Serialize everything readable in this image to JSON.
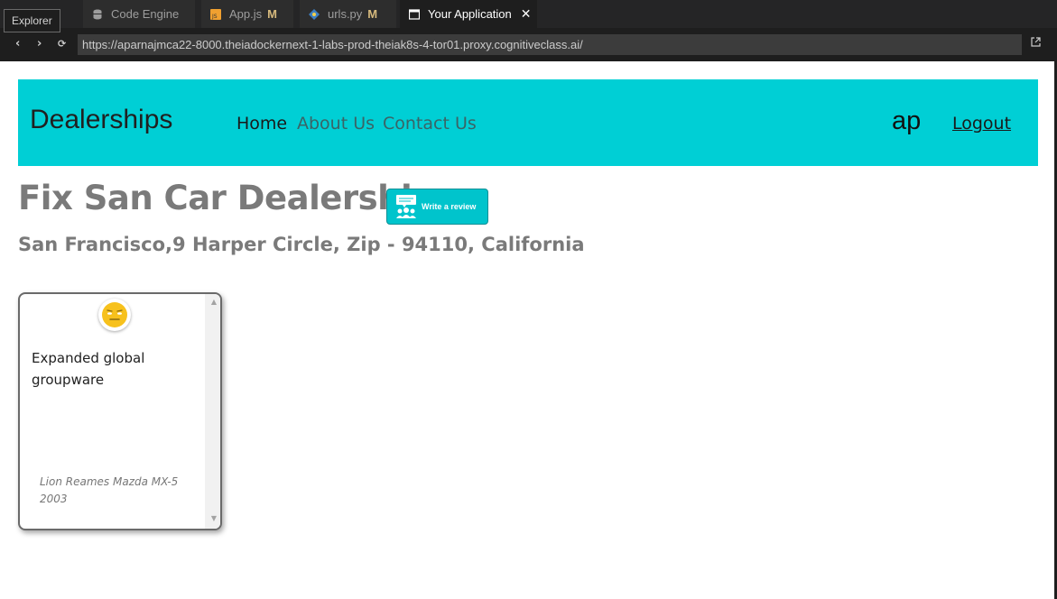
{
  "tooltip": {
    "explorer": "Explorer"
  },
  "tabs": [
    {
      "label": "Code Engine",
      "icon": "database-icon",
      "modified": ""
    },
    {
      "label": "App.js",
      "icon": "js-file-icon",
      "modified": "M"
    },
    {
      "label": "urls.py",
      "icon": "python-file-icon",
      "modified": "M"
    },
    {
      "label": "Your Application",
      "icon": "browser-preview-icon",
      "modified": ""
    }
  ],
  "browser": {
    "url": "https://aparnajmca22-8000.theiadockernext-1-labs-prod-theiak8s-4-tor01.proxy.cognitiveclass.ai/"
  },
  "app": {
    "brand": "Dealerships",
    "nav": {
      "home": "Home",
      "about": "About Us",
      "contact": "Contact Us"
    },
    "user": "ap",
    "logout": "Logout",
    "dealer_name": "Fix San Car Dealership",
    "review_button_label": "Write a review",
    "address": "San Francisco,9 Harper Circle, Zip - 94110, California",
    "reviews": [
      {
        "sentiment_icon": "neutral-face-icon",
        "text": "Expanded global groupware",
        "car": "Lion Reames Mazda MX-5 2003"
      }
    ]
  },
  "colors": {
    "header_bg": "#00cfd5",
    "review_button_bg": "#00c4cc",
    "ide_bg": "#1e1e1e",
    "modified_marker": "#d7ba7d"
  }
}
